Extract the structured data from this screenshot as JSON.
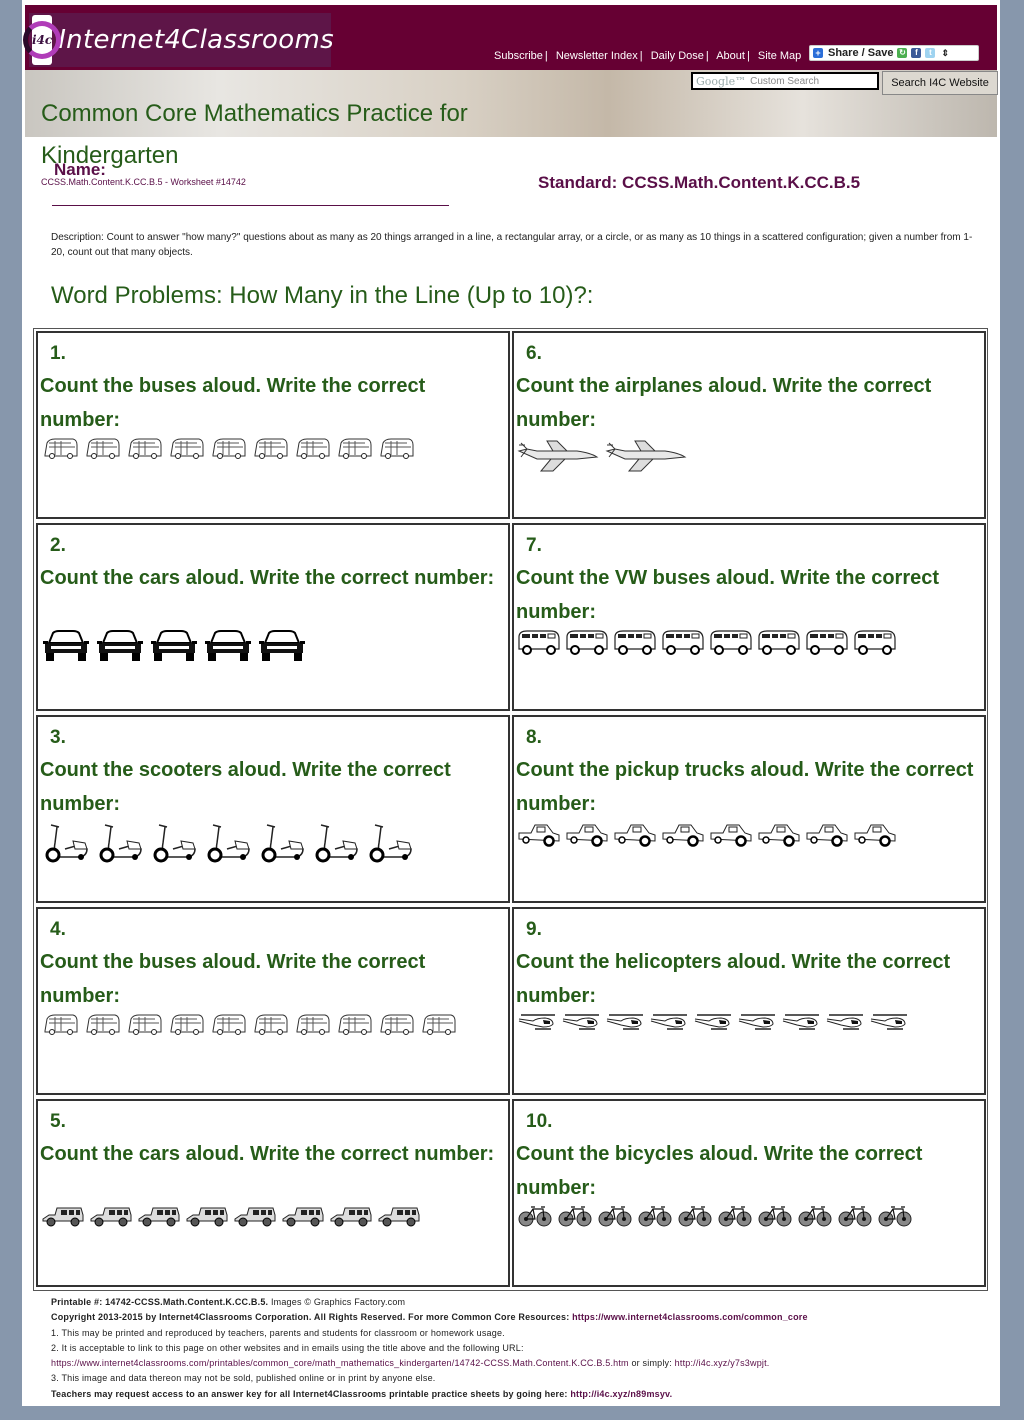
{
  "header": {
    "logo_mark": "i4c",
    "logo_text": "Internet4Classrooms",
    "nav": [
      "Subscribe",
      "Newsletter Index",
      "Daily Dose",
      "About",
      "Site Map"
    ],
    "share_label": "Share / Save",
    "search_brand": "Google™",
    "search_placeholder": "Custom Search",
    "search_button": "Search I4C Website"
  },
  "title": "Common Core Mathematics Practice for Kindergarten",
  "name_label": "Name:",
  "worksheet_id": "CCSS.Math.Content.K.CC.B.5 - Worksheet #14742",
  "standard": "Standard: CCSS.Math.Content.K.CC.B.5",
  "description": "Description: Count to answer \"how many?\" questions about as many as 20 things arranged in a line, a rectangular array, or a circle, or as many as 10 things in a scattered configuration; given a number from 1-20, count out that many objects.",
  "section_title": "Word Problems: How Many in the Line (Up to 10)?:",
  "problems": [
    {
      "number": "1.",
      "question": "Count the buses aloud. Write the correct number:",
      "object": "bus",
      "count": 9
    },
    {
      "number": "2.",
      "question": "Count the cars aloud. Write the correct number:",
      "object": "car-front",
      "count": 5
    },
    {
      "number": "3.",
      "question": "Count the scooters aloud. Write the correct number:",
      "object": "scooter",
      "count": 7
    },
    {
      "number": "4.",
      "question": "Count the buses aloud. Write the correct number:",
      "object": "bus",
      "count": 10
    },
    {
      "number": "5.",
      "question": "Count the cars aloud. Write the correct number:",
      "object": "car-vintage",
      "count": 8
    },
    {
      "number": "6.",
      "question": "Count the airplanes aloud. Write the correct number:",
      "object": "airplane",
      "count": 2
    },
    {
      "number": "7.",
      "question": "Count the VW buses aloud. Write the correct number:",
      "object": "vw-bus",
      "count": 8
    },
    {
      "number": "8.",
      "question": "Count the pickup trucks aloud. Write the correct number:",
      "object": "pickup-truck",
      "count": 8
    },
    {
      "number": "9.",
      "question": "Count the helicopters aloud. Write the correct number:",
      "object": "helicopter",
      "count": 9
    },
    {
      "number": "10.",
      "question": "Count the bicycles aloud. Write the correct number:",
      "object": "bicycle",
      "count": 10
    }
  ],
  "footer": {
    "printable": "Printable #: 14742-CCSS.Math.Content.K.CC.B.5.",
    "images_credit": "Images © Graphics Factory.com",
    "copyright": "Copyright 2013-2015 by Internet4Classrooms Corporation. All Rights Reserved. For more Common Core Resources:",
    "common_core_link": "https://www.internet4classrooms.com/common_core",
    "note1": "1. This may be printed and reproduced by teachers, parents and students for classroom or homework usage.",
    "note2": "2. It is acceptable to link to this page on other websites and in emails using the title above and the following URL:",
    "page_url": "https://www.internet4classrooms.com/printables/common_core/math_mathematics_kindergarten/14742-CCSS.Math.Content.K.CC.B.5.htm",
    "or_simply": "or simply:",
    "short_url": "http://i4c.xyz/y7s3wpjt.",
    "note3": "3. This image and data thereon may not be sold, published online or in print by anyone else.",
    "answer_key_text": "Teachers may request access to an answer key for all Internet4Classrooms printable practice sheets by going here:",
    "answer_key_link": "http://i4c.xyz/n89msyv."
  }
}
